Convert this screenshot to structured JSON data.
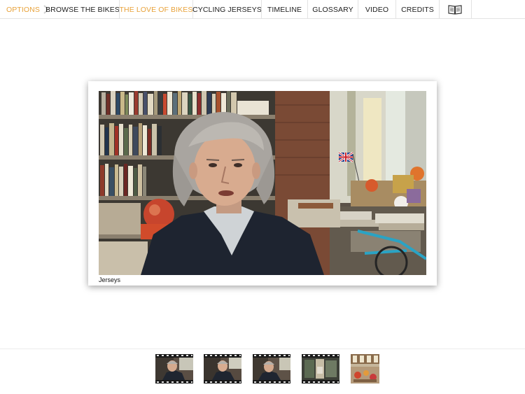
{
  "nav": {
    "options": "OPTIONS",
    "browse": "BROWSE THE BIKES",
    "love": "THE LOVE OF BIKES",
    "jerseys": "CYCLING JERSEYS",
    "timeline": "TIMELINE",
    "glossary": "GLOSSARY",
    "video": "VIDEO",
    "credits": "CREDITS",
    "book_icon": "book-icon"
  },
  "colors": {
    "accent": "#e8a23a",
    "text": "#222222",
    "divider": "#e2e2e2"
  },
  "main": {
    "video_caption": "Jerseys"
  },
  "filmstrip": {
    "thumbnails": [
      "film-frame-1",
      "film-frame-2",
      "film-frame-3",
      "film-frame-4",
      "photo-frame-5"
    ]
  }
}
